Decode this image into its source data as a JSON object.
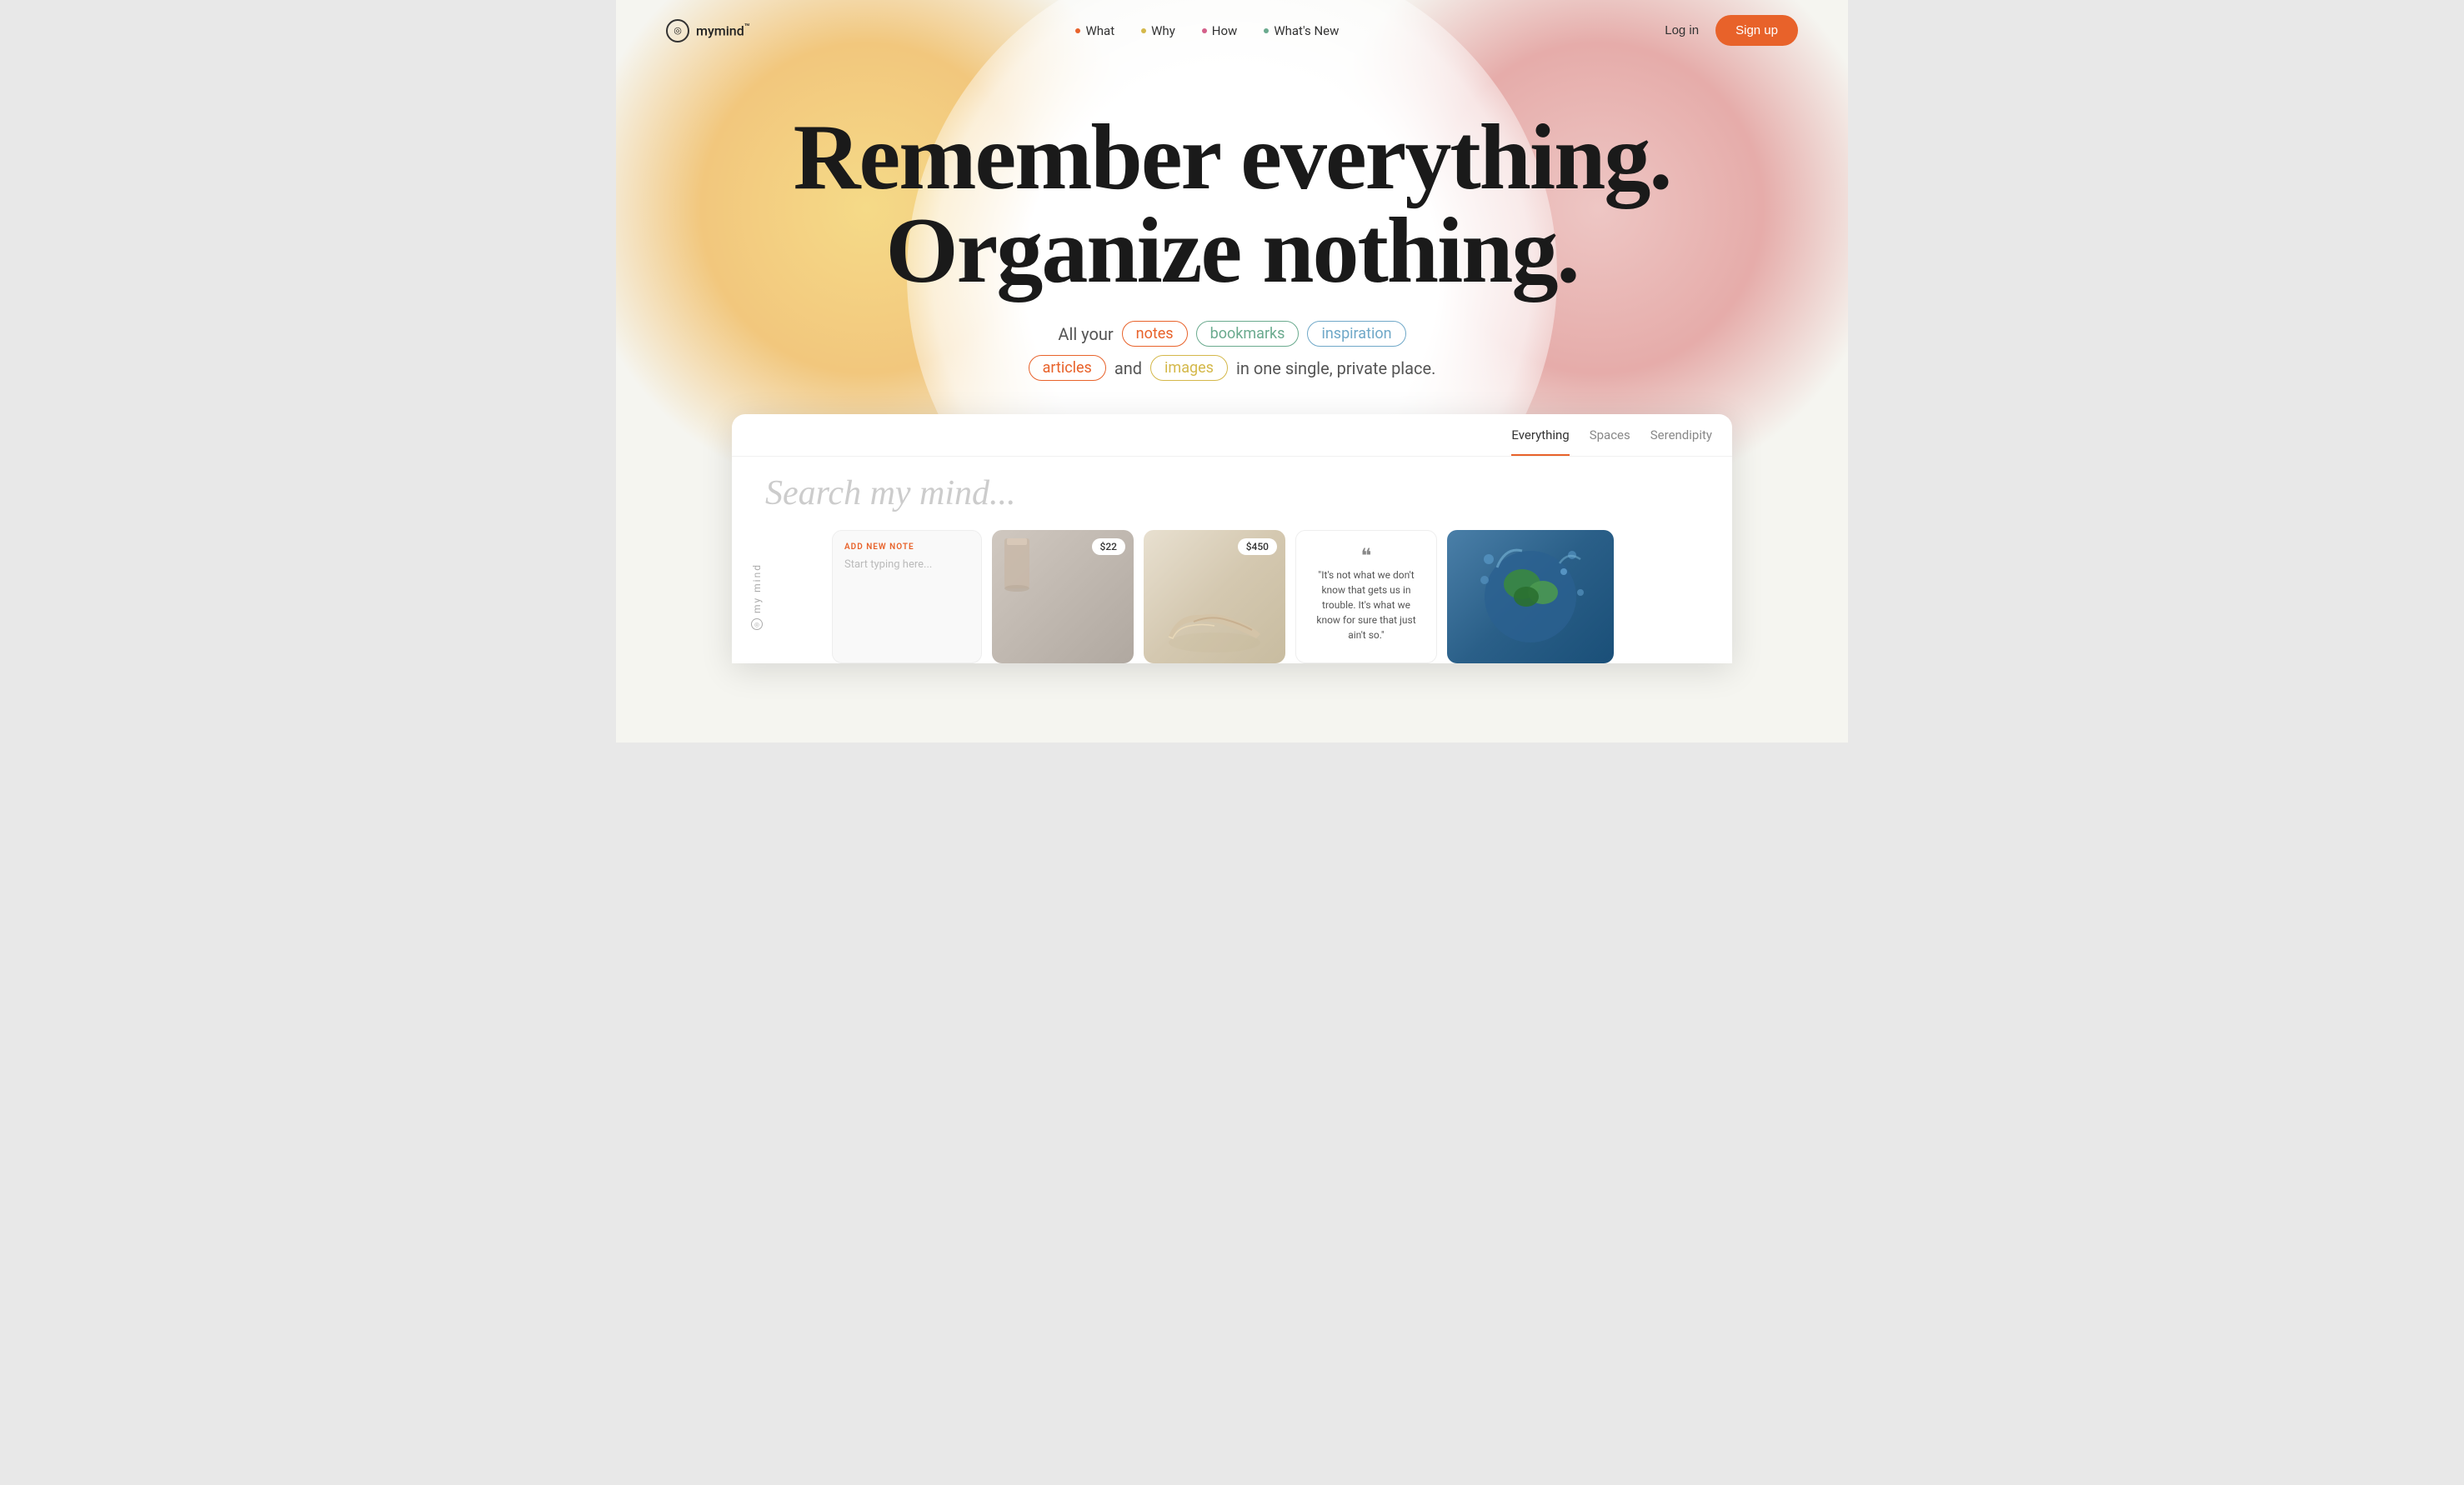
{
  "logo": {
    "icon_char": "◎",
    "name": "mymind",
    "trademark": "™"
  },
  "nav": {
    "links": [
      {
        "id": "what",
        "label": "What",
        "dot_color": "#e8622a"
      },
      {
        "id": "why",
        "label": "Why",
        "dot_color": "#d4b84a"
      },
      {
        "id": "how",
        "label": "How",
        "dot_color": "#d4608a"
      },
      {
        "id": "whats-new",
        "label": "What's New",
        "dot_color": "#6aaa8e"
      }
    ],
    "login_label": "Log in",
    "signup_label": "Sign up"
  },
  "hero": {
    "line1": "Remember everything.",
    "line2": "Organize nothing.",
    "subtitle_prefix": "All your",
    "pills": [
      {
        "id": "notes",
        "label": "notes",
        "class": "pill-notes"
      },
      {
        "id": "bookmarks",
        "label": "bookmarks",
        "class": "pill-bookmarks"
      },
      {
        "id": "inspiration",
        "label": "inspiration",
        "class": "pill-inspiration"
      }
    ],
    "subtitle_row2_prefix_pill": {
      "id": "articles",
      "label": "articles",
      "class": "pill-articles"
    },
    "and_text": "and",
    "subtitle_row2_pill": {
      "id": "images",
      "label": "images",
      "class": "pill-images"
    },
    "subtitle_suffix": "in one single, private place."
  },
  "app": {
    "tabs": [
      {
        "id": "everything",
        "label": "Everything",
        "active": true
      },
      {
        "id": "spaces",
        "label": "Spaces",
        "active": false
      },
      {
        "id": "serendipity",
        "label": "Serendipity",
        "active": false
      }
    ],
    "search_placeholder": "Search my mind...",
    "add_note_label": "ADD NEW NOTE",
    "note_placeholder": "Start typing here...",
    "cards": [
      {
        "type": "product",
        "price": "$22",
        "bg": "cup"
      },
      {
        "type": "product",
        "price": "$450",
        "bg": "sneaker"
      },
      {
        "type": "quote",
        "text": "\"It's not what we don't know that gets us in trouble. It's what we know for sure that just ain't so.\"",
        "quote_mark": "❝"
      },
      {
        "type": "image",
        "bg": "globe"
      }
    ],
    "side_label": "my mind"
  }
}
